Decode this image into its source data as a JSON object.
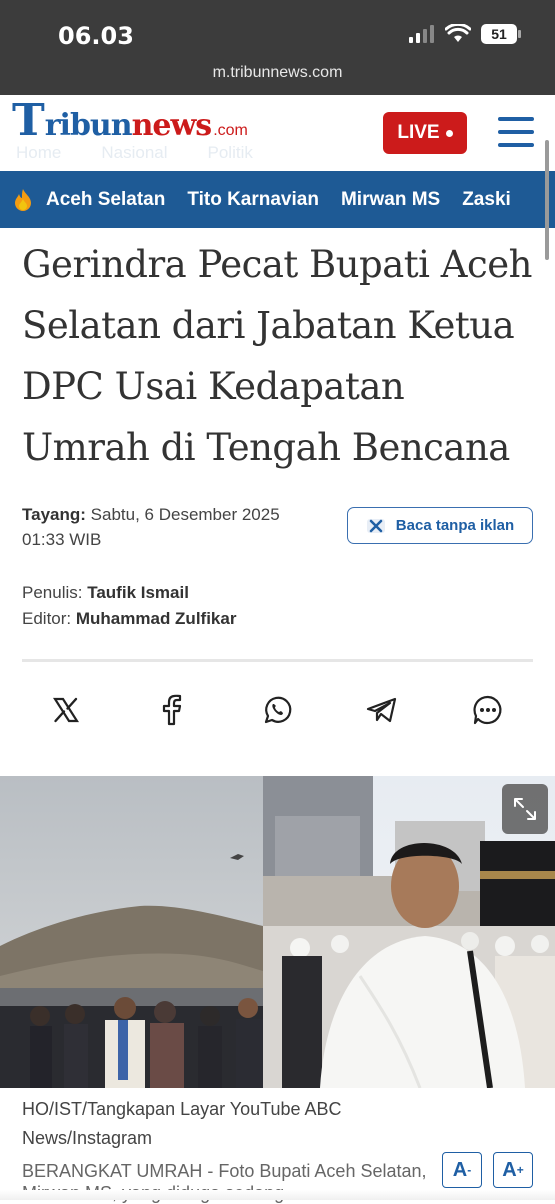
{
  "status": {
    "time": "06.03",
    "battery": "51"
  },
  "browser": {
    "url": "m.tribunnews.com"
  },
  "header": {
    "logo": {
      "t": "T",
      "ribun": "ribun",
      "news": "news",
      "com": ".com"
    },
    "breadcrumb": [
      "Home",
      "Nasional",
      "Politik"
    ],
    "live_label": "LIVE"
  },
  "topics": [
    "Aceh Selatan",
    "Tito Karnavian",
    "Mirwan MS",
    "Zaski"
  ],
  "article": {
    "title": "Gerindra Pecat Bupati Aceh Selatan dari Jabatan Ketua DPC Usai Kedapatan Umrah di Tengah Bencana",
    "tayang_label": "Tayang:",
    "tayang_date": "Sabtu, 6 Desember 2025",
    "tayang_time": "01:33 WIB",
    "no_ads_label": "Baca tanpa iklan",
    "penulis_label": "Penulis:",
    "penulis": "Taufik Ismail",
    "editor_label": "Editor:",
    "editor": "Muhammad Zulfikar"
  },
  "share_icons": [
    "x-icon",
    "facebook-icon",
    "whatsapp-icon",
    "telegram-icon",
    "comment-icon"
  ],
  "photo": {
    "source": "HO/IST/Tangkapan Layar YouTube ABC News/Instagram",
    "caption": "BERANGKAT UMRAH - Foto Bupati Aceh Selatan, Mirwan MS, yang diduga sedang"
  },
  "font_controls": {
    "decrease": "A",
    "increase": "A",
    "minus": "-",
    "plus": "+"
  },
  "colors": {
    "brand_blue": "#1f5fa4",
    "brand_red": "#cc1b1b",
    "topic_bar": "#1e5a95",
    "status_bar": "#3c3c3c"
  }
}
